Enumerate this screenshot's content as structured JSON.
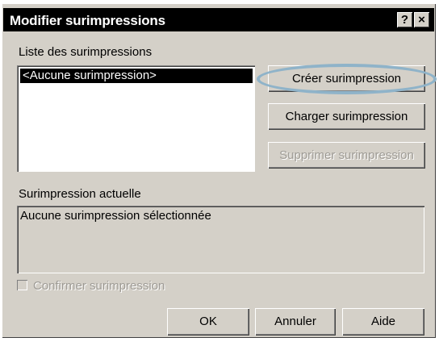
{
  "window": {
    "title": "Modifier surimpressions",
    "help_glyph": "?",
    "close_glyph": "×"
  },
  "overlay_list": {
    "label": "Liste des surimpressions",
    "items": [
      "<Aucune surimpression>"
    ],
    "selected_index": 0
  },
  "buttons": {
    "create": "Créer surimpression",
    "load": "Charger surimpression",
    "delete": "Supprimer surimpression",
    "ok": "OK",
    "cancel": "Annuler",
    "help": "Aide"
  },
  "current_overlay": {
    "label": "Surimpression actuelle",
    "value": "Aucune surimpression sélectionnée"
  },
  "confirm_checkbox": {
    "label": "Confirmer surimpression",
    "checked": false,
    "enabled": false
  },
  "colors": {
    "highlight_ring": "#8fb3c9",
    "dialog_bg": "#d4d0c8",
    "titlebar_bg": "#000000"
  }
}
